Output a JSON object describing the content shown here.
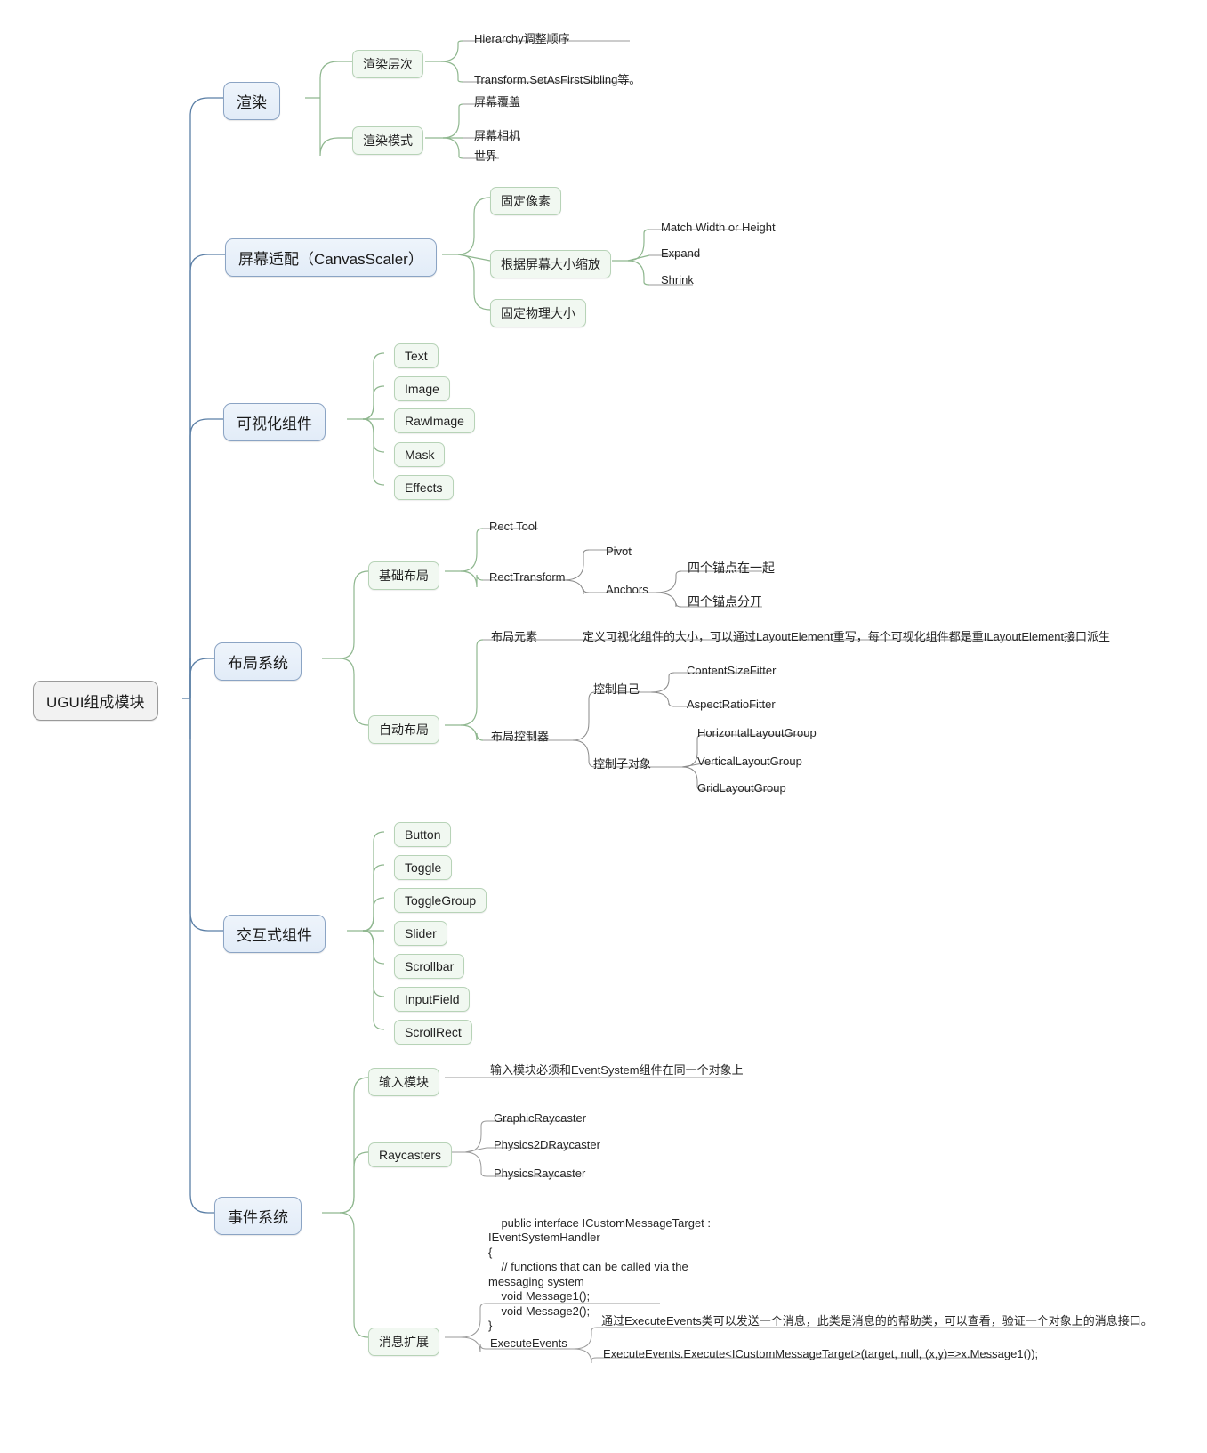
{
  "title": "UGUI组成模块",
  "colors": {
    "root_fill": "#f2f2f2",
    "root_stroke": "#9a9a9a",
    "level1_fill": "#e6eefa",
    "level1_stroke": "#8ba4c4",
    "level2_fill": "#f1f8f1",
    "level2_stroke": "#b7d3b7",
    "link_blue": "#5b7fa6",
    "link_green": "#8fb78f",
    "link_gray": "#8a8a8a",
    "text": "#262626",
    "background": "#ffffff"
  },
  "root": {
    "label": "UGUI组成模块"
  },
  "branches": [
    {
      "label": "渲染",
      "children": [
        {
          "label": "渲染层次",
          "leaves": [
            "Hierarchy调整顺序",
            "Transform.SetAsFirstSibling等。"
          ]
        },
        {
          "label": "渲染模式",
          "leaves": [
            "屏幕覆盖",
            "屏幕相机",
            "世界"
          ]
        }
      ]
    },
    {
      "label": "屏幕适配（CanvasScaler）",
      "children": [
        {
          "label": "固定像素",
          "leaves": []
        },
        {
          "label": "根据屏幕大小缩放",
          "leaves": [
            "Match Width or Height",
            "Expand",
            "Shrink"
          ]
        },
        {
          "label": "固定物理大小",
          "leaves": []
        }
      ]
    },
    {
      "label": "可视化组件",
      "children": [
        {
          "label": "Text",
          "leaves": []
        },
        {
          "label": "Image",
          "leaves": []
        },
        {
          "label": "RawImage",
          "leaves": []
        },
        {
          "label": "Mask",
          "leaves": []
        },
        {
          "label": "Effects",
          "leaves": []
        }
      ]
    },
    {
      "label": "布局系统",
      "children": [
        {
          "label": "基础布局",
          "leaves": [
            "Rect Tool",
            "RectTransform"
          ],
          "sub": [
            {
              "label": "Pivot",
              "leaves": []
            },
            {
              "label": "Anchors",
              "leaves": [
                "四个锚点在一起",
                "四个锚点分开"
              ]
            }
          ]
        },
        {
          "label": "自动布局",
          "leaves": [
            "布局元素",
            "布局控制器"
          ],
          "note": "定义可视化组件的大小，可以通过LayoutElement重写，每个可视化组件都是重ILayoutElement接口派生",
          "sub": [
            {
              "label": "控制自己",
              "leaves": [
                "ContentSizeFitter",
                "AspectRatioFitter"
              ]
            },
            {
              "label": "控制子对象",
              "leaves": [
                "HorizontalLayoutGroup",
                "VerticalLayoutGroup",
                "GridLayoutGroup"
              ]
            }
          ]
        }
      ]
    },
    {
      "label": "交互式组件",
      "children": [
        {
          "label": "Button",
          "leaves": []
        },
        {
          "label": "Toggle",
          "leaves": []
        },
        {
          "label": "ToggleGroup",
          "leaves": []
        },
        {
          "label": "Slider",
          "leaves": []
        },
        {
          "label": "Scrollbar",
          "leaves": []
        },
        {
          "label": "InputField",
          "leaves": []
        },
        {
          "label": "ScrollRect",
          "leaves": []
        }
      ]
    },
    {
      "label": "事件系统",
      "children": [
        {
          "label": "输入模块",
          "leaves": [
            "输入模块必须和EventSystem组件在同一个对象上"
          ]
        },
        {
          "label": "Raycasters",
          "leaves": [
            "GraphicRaycaster",
            "Physics2DRaycaster",
            "PhysicsRaycaster"
          ]
        },
        {
          "label": "消息扩展",
          "leaves": [],
          "code": "public interface ICustomMessageTarget :\nIEventSystemHandler\n{\n    // functions that can be called via the\nmessaging system\n    void Message1();\n    void Message2();\n}",
          "execute": {
            "label": "ExecuteEvents",
            "note": "通过ExecuteEvents类可以发送一个消息，此类是消息的的帮助类，可以查看，验证一个对象上的消息接口。",
            "code": "ExecuteEvents.Execute<ICustomMessageTarget>(target, null, (x,y)=>x.Message1());"
          }
        }
      ]
    }
  ],
  "labels": {
    "render": "渲染",
    "render_layer": "渲染层次",
    "render_mode": "渲染模式",
    "hierarchy_order": "Hierarchy调整顺序",
    "set_as_first_sibling": "Transform.SetAsFirstSibling等。",
    "screen_overlay": "屏幕覆盖",
    "screen_camera": "屏幕相机",
    "world": "世界",
    "canvas_scaler": "屏幕适配（CanvasScaler）",
    "constant_pixel": "固定像素",
    "scale_with_screen": "根据屏幕大小缩放",
    "constant_physical": "固定物理大小",
    "match_width_height": "Match Width or Height",
    "expand": "Expand",
    "shrink": "Shrink",
    "visual_components": "可视化组件",
    "text": "Text",
    "image": "Image",
    "rawimage": "RawImage",
    "mask": "Mask",
    "effects": "Effects",
    "layout_system": "布局系统",
    "basic_layout": "基础布局",
    "rect_tool": "Rect Tool",
    "rect_transform": "RectTransform",
    "pivot": "Pivot",
    "anchors": "Anchors",
    "anchors_together": "四个锚点在一起",
    "anchors_apart": "四个锚点分开",
    "auto_layout": "自动布局",
    "layout_element": "布局元素",
    "layout_element_desc": "定义可视化组件的大小，可以通过LayoutElement重写，每个可视化组件都是重ILayoutElement接口派生",
    "layout_controller": "布局控制器",
    "control_self": "控制自己",
    "content_size_fitter": "ContentSizeFitter",
    "aspect_ratio_fitter": "AspectRatioFitter",
    "control_children": "控制子对象",
    "horizontal_layout_group": "HorizontalLayoutGroup",
    "vertical_layout_group": "VerticalLayoutGroup",
    "grid_layout_group": "GridLayoutGroup",
    "interactive_components": "交互式组件",
    "button": "Button",
    "toggle": "Toggle",
    "toggle_group": "ToggleGroup",
    "slider": "Slider",
    "scrollbar": "Scrollbar",
    "input_field": "InputField",
    "scroll_rect": "ScrollRect",
    "event_system": "事件系统",
    "input_module": "输入模块",
    "input_module_desc": "输入模块必须和EventSystem组件在同一个对象上",
    "raycasters": "Raycasters",
    "graphic_raycaster": "GraphicRaycaster",
    "physics2d_raycaster": "Physics2DRaycaster",
    "physics_raycaster": "PhysicsRaycaster",
    "message_extension": "消息扩展",
    "interface_code": "public interface ICustomMessageTarget :\nIEventSystemHandler\n{\n    // functions that can be called via the\nmessaging system\n    void Message1();\n    void Message2();\n}",
    "execute_events": "ExecuteEvents",
    "execute_events_desc": "通过ExecuteEvents类可以发送一个消息，此类是消息的的帮助类，可以查看，验证一个对象上的消息接口。",
    "execute_events_code": "ExecuteEvents.Execute<ICustomMessageTarget>(target, null, (x,y)=>x.Message1());"
  }
}
